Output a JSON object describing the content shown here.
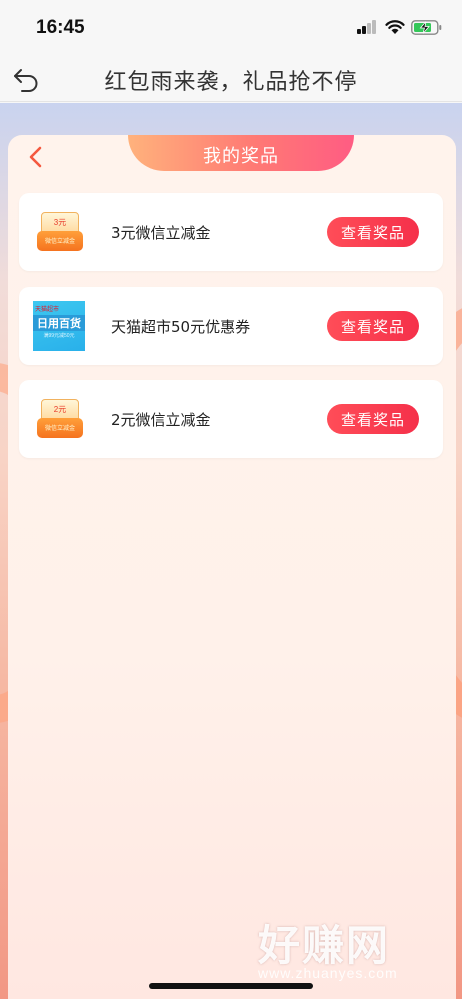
{
  "status_bar": {
    "time": "16:45",
    "signal_icon": "signal-icon",
    "wifi_icon": "wifi-icon",
    "battery_icon": "battery-charging-icon"
  },
  "nav": {
    "title": "红包雨来袭，礼品抢不停",
    "back_icon": "back-arrow-icon"
  },
  "panel": {
    "title": "我的奖品",
    "back_icon": "chevron-left-icon"
  },
  "prizes": [
    {
      "name": "3元微信立减金",
      "button": "查看奖品",
      "thumb_top": "3元",
      "thumb_base": "微信立减金",
      "thumb_icon": "coupon-coin-icon"
    },
    {
      "name": "天猫超市50元优惠券",
      "button": "查看奖品",
      "thumb_brand": "天猫超市",
      "thumb_text": "日用百货",
      "thumb_sub": "满99元减50元",
      "thumb_icon": "tmall-coupon-icon"
    },
    {
      "name": "2元微信立减金",
      "button": "查看奖品",
      "thumb_top": "2元",
      "thumb_base": "微信立减金",
      "thumb_icon": "coupon-coin-icon"
    }
  ],
  "watermark": {
    "title": "好赚网",
    "url": "www.zhuanyes.com"
  },
  "colors": {
    "accent": "#f5304a",
    "tab_gradient_start": "#ffb27c",
    "tab_gradient_end": "#ff5c83"
  }
}
